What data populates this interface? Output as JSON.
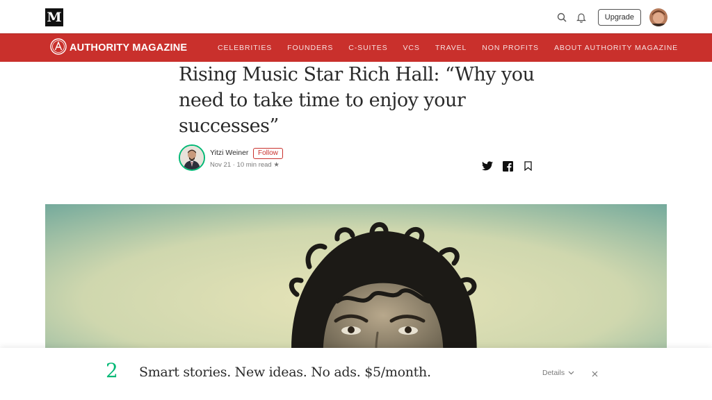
{
  "topbar": {
    "logo_letter": "M",
    "upgrade_label": "Upgrade",
    "icons": [
      "search-icon",
      "bell-icon"
    ]
  },
  "publication": {
    "name": "AUTHORITY MAGAZINE",
    "nav": [
      "CELEBRITIES",
      "FOUNDERS",
      "C-SUITES",
      "VCS",
      "TRAVEL",
      "NON PROFITS",
      "ABOUT AUTHORITY MAGAZINE"
    ],
    "brand_color": "#c9302c"
  },
  "article": {
    "title_line1": "Rising Music Star Rich Hall: “Why you",
    "title_line2": "need to take time to enjoy your",
    "title_line3": "successes”",
    "author": "Yitzi Weiner",
    "follow_label": "Follow",
    "meta": "Nov 21 · 10 min read ★",
    "share_icons": [
      "twitter-icon",
      "facebook-icon",
      "bookmark-icon"
    ]
  },
  "promo": {
    "count": "2",
    "text": "Smart stories. New ideas. No ads. $5/month.",
    "details_label": "Details",
    "accent_color": "#02b875"
  }
}
